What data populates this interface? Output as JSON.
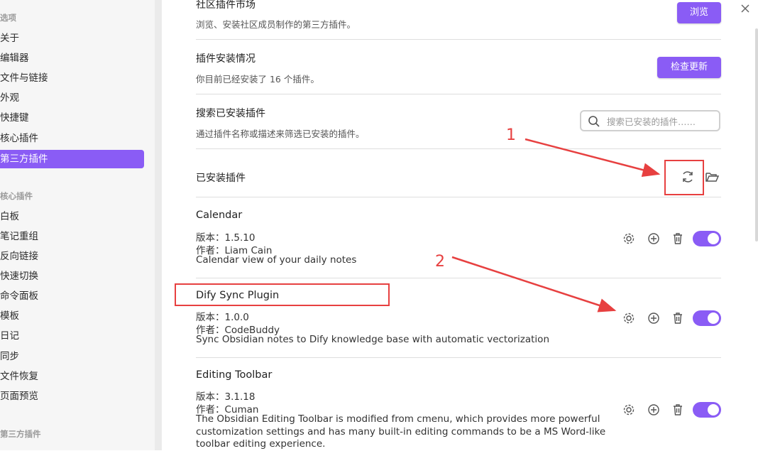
{
  "sidebar": {
    "heading_options": "选项",
    "options": [
      "关于",
      "编辑器",
      "文件与链接",
      "外观",
      "快捷键",
      "核心插件",
      "第三方插件"
    ],
    "active_index": 6,
    "heading_core": "核心插件",
    "core_items": [
      "白板",
      "笔记重组",
      "反向链接",
      "快速切换",
      "命令面板",
      "模板",
      "日记",
      "同步",
      "文件恢复",
      "页面预览"
    ],
    "heading_third": "第三方插件"
  },
  "market": {
    "title": "社区插件市场",
    "desc": "浏览、安装社区成员制作的第三方插件。",
    "button": "浏览"
  },
  "install_status": {
    "title": "插件安装情况",
    "desc": "你目前已经安装了 16 个插件。",
    "button": "检查更新"
  },
  "search": {
    "title": "搜索已安装插件",
    "desc": "通过插件名称或描述来筛选已安装的插件。",
    "placeholder": "搜索已安装的插件……"
  },
  "installed": {
    "title": "已安装插件"
  },
  "plugins": [
    {
      "name": "Calendar",
      "version": "版本：1.5.10",
      "author": "作者：Liam Cain",
      "desc": "Calendar view of your daily notes",
      "enabled": true
    },
    {
      "name": "Dify Sync Plugin",
      "version": "版本：1.0.0",
      "author": "作者：CodeBuddy",
      "desc": "Sync Obsidian notes to Dify knowledge base with automatic vectorization",
      "enabled": true
    },
    {
      "name": "Editing Toolbar",
      "version": "版本：3.1.18",
      "author": "作者：Cuman",
      "desc": "The Obsidian Editing Toolbar is modified from cmenu, which provides more powerful customization settings and has many built-in editing commands to be a MS Word-like toolbar editing experience.",
      "enabled": true
    }
  ],
  "annotations": {
    "label_1": "1",
    "label_2": "2",
    "color": "#e74040"
  },
  "colors": {
    "accent": "#8a5cf5"
  }
}
